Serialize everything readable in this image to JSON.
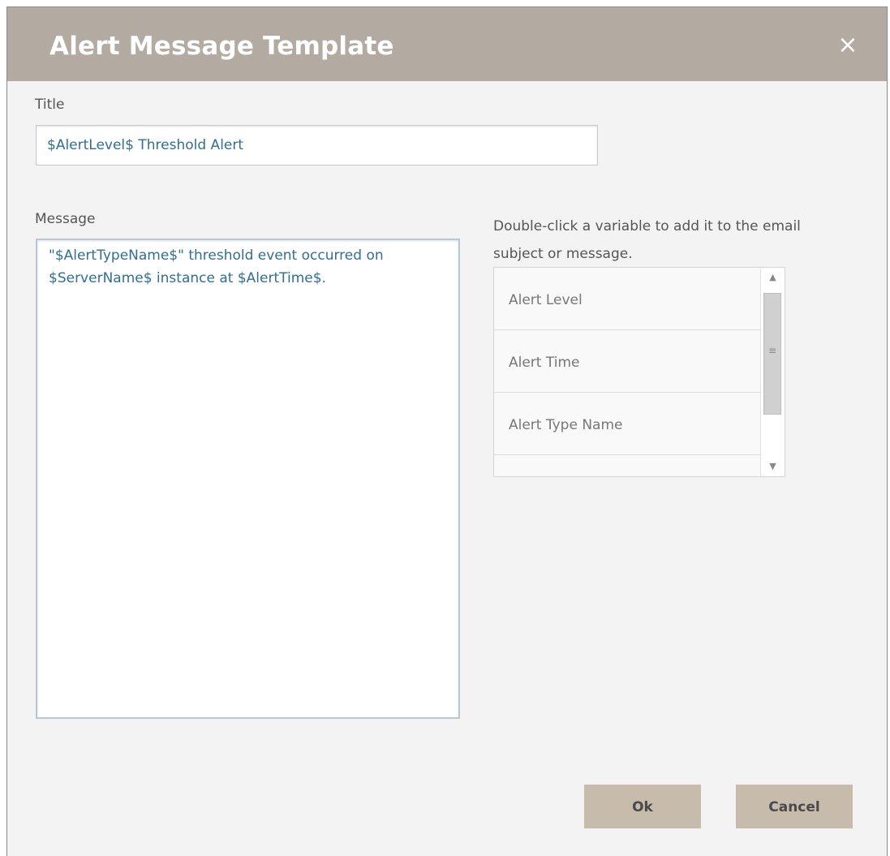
{
  "dialog": {
    "title": "Alert Message Template",
    "close_icon": "×"
  },
  "title_field": {
    "label": "Title",
    "value": "$AlertLevel$ Threshold Alert"
  },
  "message_field": {
    "label": "Message",
    "value": "\"$AlertTypeName$\" threshold event occurred on $ServerName$ instance at $AlertTime$."
  },
  "variables": {
    "hint": "Double-click a variable to add it to the email subject or message.",
    "items": [
      {
        "label": "Alert Level"
      },
      {
        "label": "Alert Time"
      },
      {
        "label": "Alert Type Name"
      },
      {
        "label": ""
      }
    ],
    "scroll_up_icon": "▲",
    "scroll_down_icon": "▼",
    "scroll_grip_icon": "≡"
  },
  "buttons": {
    "ok_label": "Ok",
    "cancel_label": "Cancel"
  },
  "colors": {
    "titlebar": "#b3aba2",
    "button": "#c7bcac",
    "field_text": "#2f6f94"
  }
}
